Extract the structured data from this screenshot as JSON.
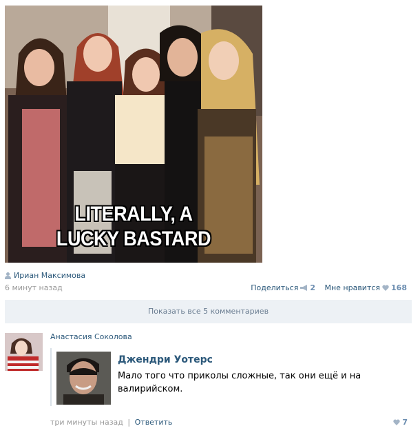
{
  "post": {
    "image_caption_line1": "LITERALLY, A",
    "image_caption_line2": "LUCKY BASTARD",
    "author": "Ириан Максимова",
    "time": "6 минут назад",
    "share_label": "Поделиться",
    "share_count": "2",
    "like_label": "Мне нравится",
    "like_count": "168"
  },
  "comments": {
    "show_all_label": "Показать все 5 комментариев",
    "items": [
      {
        "author": "Анастасия Соколова",
        "quote_name": "Джендри Уотерс",
        "quote_text": "Мало того что приколы сложные, так они ещё и на валирийском.",
        "time": "три минуты назад",
        "separator": "|",
        "reply_label": "Ответить",
        "like_count": "7"
      }
    ]
  },
  "colors": {
    "link": "#2b587a",
    "muted": "#999999",
    "bar_bg": "#edf1f5",
    "like_accent": "#6b8db0"
  },
  "icons": [
    "person-icon",
    "megaphone-icon",
    "heart-icon"
  ]
}
